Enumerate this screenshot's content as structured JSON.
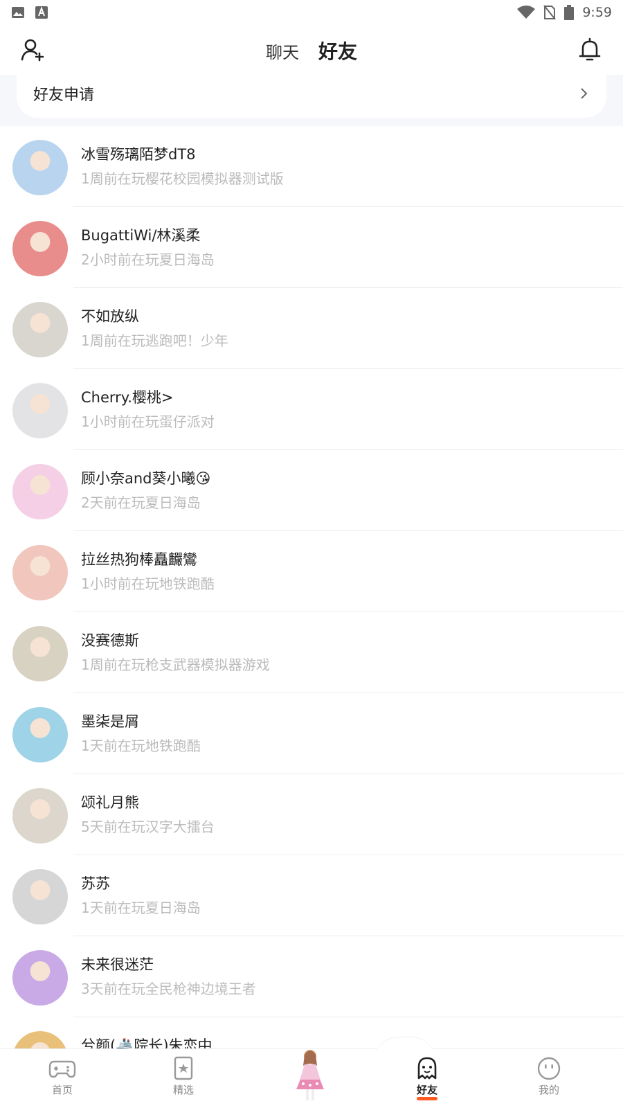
{
  "status_bar": {
    "time": "9:59"
  },
  "header": {
    "tabs": [
      {
        "label": "聊天",
        "active": false
      },
      {
        "label": "好友",
        "active": true
      }
    ]
  },
  "friend_request": {
    "label": "好友申请"
  },
  "friends": [
    {
      "name": "冰雪殇璃陌梦dT8",
      "status": "1周前在玩樱花校园模拟器测试版",
      "avatar_color": "#b8d4ef"
    },
    {
      "name": "BugattiWi/林溪柔",
      "status": "2小时前在玩夏日海岛",
      "avatar_color": "#e98c8c"
    },
    {
      "name": "不如放纵",
      "status": "1周前在玩逃跑吧！少年",
      "avatar_color": "#d9d6cf"
    },
    {
      "name": "Cherry.樱桃>",
      "status": "1小时前在玩蛋仔派对",
      "avatar_color": "#e3e3e6"
    },
    {
      "name": "顾小奈and葵小曦😘",
      "status": "2天前在玩夏日海岛",
      "avatar_color": "#f4cfe6"
    },
    {
      "name": "拉丝热狗棒矗麣鸞",
      "status": "1小时前在玩地铁跑酷",
      "avatar_color": "#f0c6bd"
    },
    {
      "name": "没赛德斯",
      "status": "1周前在玩枪支武器模拟器游戏",
      "avatar_color": "#d8d2c2"
    },
    {
      "name": "墨柒是屑",
      "status": "1天前在玩地铁跑酷",
      "avatar_color": "#9fd3e8"
    },
    {
      "name": "颂礼月熊",
      "status": "5天前在玩汉字大擂台",
      "avatar_color": "#dcd6cc"
    },
    {
      "name": "苏苏",
      "status": "1天前在玩夏日海岛",
      "avatar_color": "#d6d6d6"
    },
    {
      "name": "未来很迷茫",
      "status": "3天前在玩全民枪神边境王者",
      "avatar_color": "#c9a9e6"
    },
    {
      "name": "兮颜(🚢院长)朱恋中",
      "status": "",
      "avatar_color": "#e8c07a"
    }
  ],
  "bottom_nav": {
    "items": [
      {
        "label": "首页",
        "icon": "gamepad-icon",
        "active": false
      },
      {
        "label": "精选",
        "icon": "star-card-icon",
        "active": false
      },
      {
        "label": "好友",
        "icon": "ghost-icon",
        "active": true
      },
      {
        "label": "我的",
        "icon": "smiley-icon",
        "active": false
      }
    ]
  },
  "colors": {
    "accent": "#ff5a1f",
    "muted_text": "#bbbbbb",
    "background_strip": "#f5f7fa"
  }
}
